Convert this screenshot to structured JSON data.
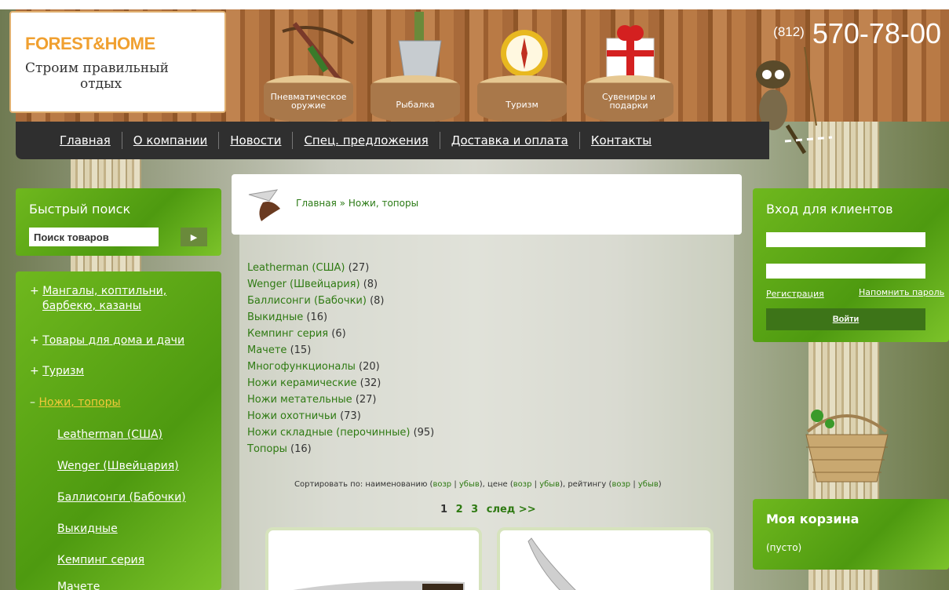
{
  "header": {
    "logo_title_a": "FOREST",
    "logo_amp": "&",
    "logo_title_b": "HOME",
    "slogan_line1": "Строим правильный",
    "slogan_line2": "отдых",
    "phone_code": "(812)",
    "phone_number": "570-78-00",
    "categories": [
      {
        "line1": "Пневматическое",
        "line2": "оружие",
        "icon": "crossbow-icon"
      },
      {
        "line1": "Рыбалка",
        "line2": "",
        "icon": "bucket-icon"
      },
      {
        "line1": "Туризм",
        "line2": "",
        "icon": "compass-icon"
      },
      {
        "line1": "Сувениры и",
        "line2": "подарки",
        "icon": "gift-icon"
      }
    ]
  },
  "nav": [
    "Главная",
    "О компании",
    "Новости",
    "Спец. предложения",
    "Доставка и оплата",
    "Контакты"
  ],
  "quick_search": {
    "title": "Быстрый поиск",
    "value": "Поиск товаров",
    "button": "▶"
  },
  "side_menu": {
    "items": [
      {
        "prefix": "+",
        "label_line1": "Мангалы, коптильни,",
        "label_line2": "барбекю, казаны"
      },
      {
        "prefix": "+",
        "label_line1": "Товары для дома и дачи",
        "label_line2": ""
      },
      {
        "prefix": "+",
        "label_line1": "Туризм",
        "label_line2": ""
      },
      {
        "prefix": "–",
        "label_line1": "Ножи, топоры",
        "label_line2": ""
      }
    ],
    "sub": [
      "Leatherman (США)",
      "Wenger (Швейцария)",
      "Баллисонги (Бабочки)",
      "Выкидные",
      "Кемпинг серия",
      "Мачете"
    ]
  },
  "breadcrumb": {
    "home": "Главная",
    "sep": "»",
    "current": "Ножи, топоры"
  },
  "categories_list": [
    {
      "name": "Leatherman (США)",
      "count": "(27)"
    },
    {
      "name": "Wenger (Швейцария)",
      "count": "(8)"
    },
    {
      "name": "Баллисонги (Бабочки)",
      "count": "(8)"
    },
    {
      "name": "Выкидные",
      "count": "(16)"
    },
    {
      "name": "Кемпинг серия",
      "count": "(6)"
    },
    {
      "name": "Мачете",
      "count": "(15)"
    },
    {
      "name": "Многофункционалы",
      "count": "(20)"
    },
    {
      "name": "Ножи керамические",
      "count": "(32)"
    },
    {
      "name": "Ножи метательные",
      "count": "(27)"
    },
    {
      "name": "Ножи охотничьи",
      "count": "(73)"
    },
    {
      "name": "Ножи складные (перочинные)",
      "count": "(95)"
    },
    {
      "name": "Топоры",
      "count": "(16)"
    }
  ],
  "sort": {
    "prefix": "Сортировать по: наименованию (",
    "asc": "возр",
    "bar": "|",
    "desc": "убыв",
    "mid1": "), цене (",
    "mid2": "), рейтингу (",
    "end": ")"
  },
  "pagination": {
    "current": "1",
    "p2": "2",
    "p3": "3",
    "next": "след >>"
  },
  "login": {
    "title": "Вход для клиентов",
    "register": "Регистрация",
    "remind": "Напомнить пароль",
    "button": "Войти"
  },
  "cart": {
    "title": "Моя корзина",
    "status": "(пусто)"
  }
}
